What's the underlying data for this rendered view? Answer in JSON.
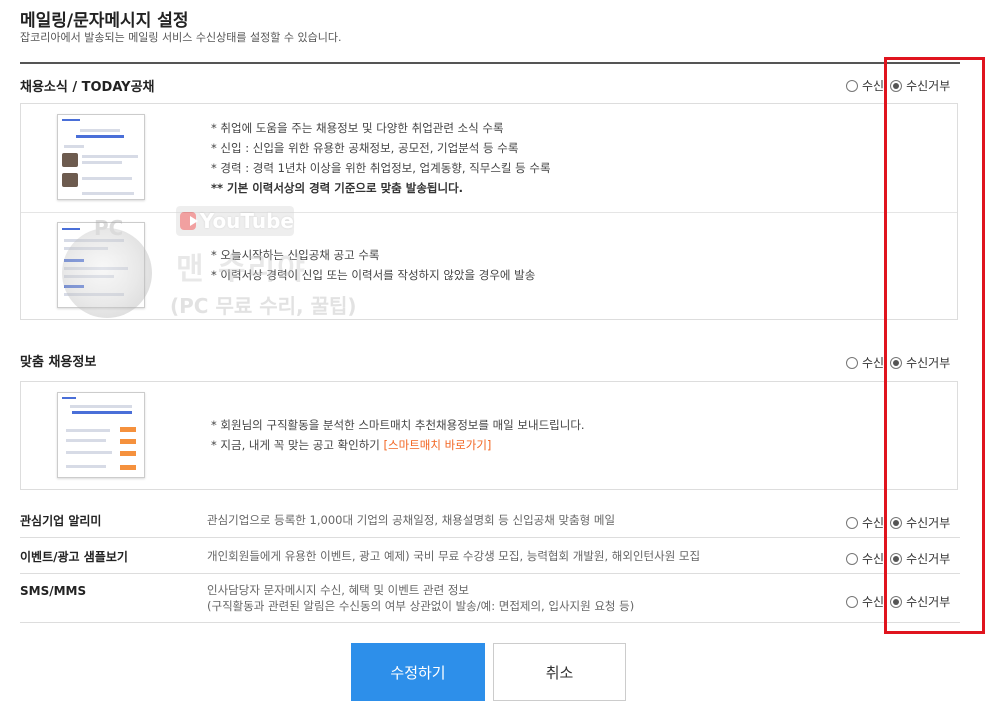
{
  "page": {
    "title": "메일링/문자메시지 설정",
    "description": "잡코리아에서 발송되는 메일링 서비스 수신상태를 설정할 수 있습니다."
  },
  "radio_labels": {
    "receive": "수신",
    "reject": "수신거부"
  },
  "sections": {
    "news": {
      "title": "채용소식 / TODAY공채",
      "selected": "reject",
      "rows": [
        {
          "lines": [
            "* 취업에 도움을 주는 채용정보 및 다양한 취업관련 소식 수록",
            "* 신입 : 신입을 위한 유용한 공채정보, 공모전, 기업분석 등 수록",
            "* 경력 : 경력 1년차 이상을 위한 취업정보, 업계동향, 직무스킬 등 수록",
            "** 기본 이력서상의 경력 기준으로 맞춤 발송됩니다."
          ]
        },
        {
          "lines": [
            "* 오늘시작하는 신입공채 공고 수록",
            "* 이력서상 경력이 신입 또는 이력서를 작성하지 않았을 경우에 발송"
          ]
        }
      ]
    },
    "custom": {
      "title": "맞춤 채용정보",
      "selected": "reject",
      "lines": [
        "* 회원님의 구직활동을 분석한 스마트매치 추천채용정보를 매일 보내드립니다.",
        "* 지금, 내게 꼭 맞는 공고 확인하기 "
      ],
      "link": "[스마트매치 바로가기]"
    }
  },
  "rows": [
    {
      "label": "관심기업 알리미",
      "desc": "관심기업으로 등록한 1,000대 기업의 공채일정, 채용설명회 등 신입공채 맞춤형 메일",
      "selected": "reject"
    },
    {
      "label": "이벤트/광고 샘플보기",
      "desc": "개인회원들에게 유용한 이벤트, 광고 예제) 국비 무료 수강생 모집, 능력협회 개발원, 해외인턴사원 모집",
      "selected": "reject"
    },
    {
      "label": "SMS/MMS",
      "desc": "인사담당자 문자메시지 수신, 혜택 및 이벤트 관련 정보",
      "desc2": "(구직활동과 관련된 알림은 수신동의 여부 상관없이 발송/예: 면접제의, 입사지원 요청 등)",
      "selected": "reject"
    }
  ],
  "buttons": {
    "submit": "수정하기",
    "cancel": "취소"
  },
  "watermark": {
    "youtube": "YouTube",
    "pc": "PC",
    "channel": "맨 수리야",
    "tagline": "(PC 무료 수리, 꿀팁)"
  },
  "colors": {
    "primary": "#2d8fea",
    "highlight": "#e0141e",
    "link": "#f26522"
  }
}
